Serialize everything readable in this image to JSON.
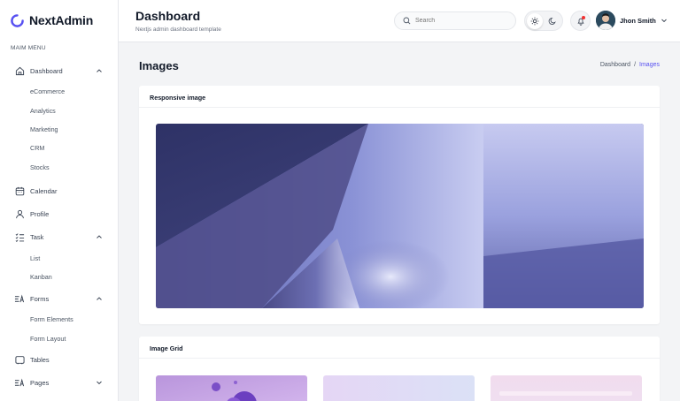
{
  "brand": {
    "name": "NextAdmin"
  },
  "sidebar": {
    "menu_title": "MAIM MENU",
    "dashboard": {
      "label": "Dashboard",
      "sub": [
        "eCommerce",
        "Analytics",
        "Marketing",
        "CRM",
        "Stocks"
      ]
    },
    "calendar": {
      "label": "Calendar"
    },
    "profile": {
      "label": "Profile"
    },
    "task": {
      "label": "Task",
      "sub": [
        "List",
        "Kanban"
      ]
    },
    "forms": {
      "label": "Forms",
      "sub": [
        "Form Elements",
        "Form Layout"
      ]
    },
    "tables": {
      "label": "Tables"
    },
    "pages": {
      "label": "Pages"
    }
  },
  "header": {
    "title": "Dashboard",
    "subtitle": "Nextjs admin dashboard template",
    "search_placeholder": "Search",
    "user_name": "Jhon Smith"
  },
  "main": {
    "title": "Images",
    "breadcrumb": {
      "home": "Dashboard",
      "separator": "/",
      "current": "Images"
    },
    "cards": {
      "responsive": {
        "title": "Responsive image"
      },
      "grid": {
        "title": "Image Grid"
      }
    }
  },
  "colors": {
    "accent": "#5750f1",
    "notification": "#f23030"
  },
  "icons": [
    "logo-icon",
    "dashboard-icon",
    "calendar-icon",
    "profile-icon",
    "task-icon",
    "forms-icon",
    "tables-icon",
    "pages-icon",
    "search-icon",
    "sun-icon",
    "moon-icon",
    "bell-icon",
    "chevron-down-icon",
    "chevron-up-icon"
  ]
}
